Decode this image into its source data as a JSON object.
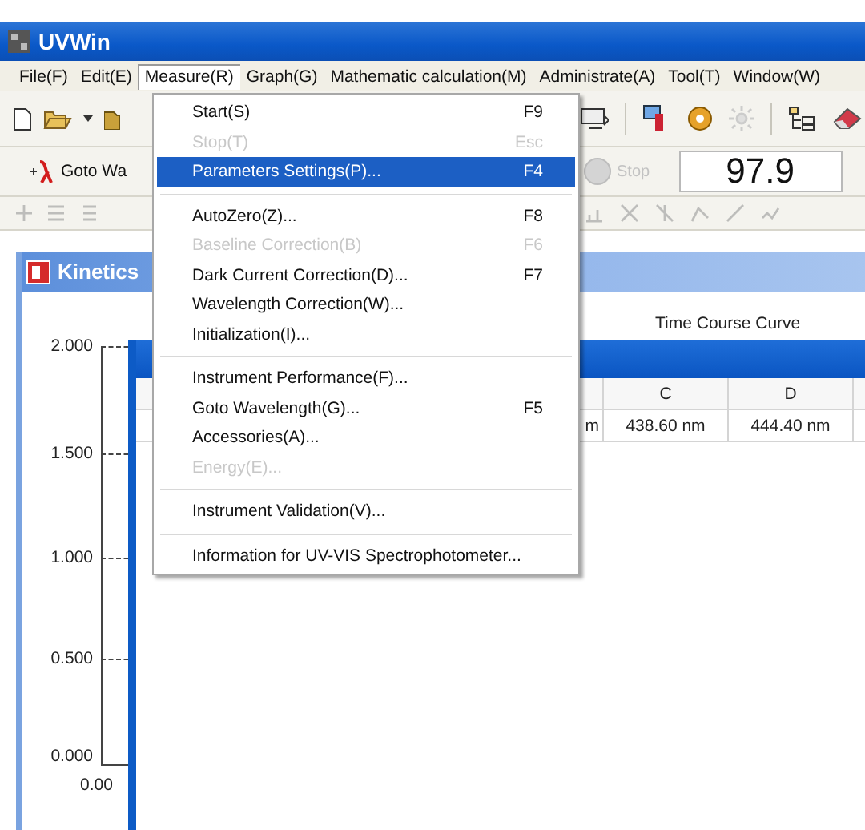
{
  "window": {
    "title": "UVWin"
  },
  "menu_bar": [
    {
      "label": "File(F)",
      "selected": false
    },
    {
      "label": "Edit(E)",
      "selected": false
    },
    {
      "label": "Measure(R)",
      "selected": true
    },
    {
      "label": "Graph(G)",
      "selected": false
    },
    {
      "label": "Mathematic calculation(M)",
      "selected": false
    },
    {
      "label": "Administrate(A)",
      "selected": false
    },
    {
      "label": "Tool(T)",
      "selected": false
    },
    {
      "label": "Window(W)",
      "selected": false
    }
  ],
  "toolbar": {
    "goto_button": "Goto Wa",
    "stop_button": {
      "label": "Stop",
      "disabled": true
    },
    "reading": "97.9"
  },
  "measure_menu": [
    {
      "kind": "item",
      "label": "Start(S)",
      "shortcut": "F9",
      "disabled": false,
      "selected": false
    },
    {
      "kind": "item",
      "label": "Stop(T)",
      "shortcut": "Esc",
      "disabled": true,
      "selected": false
    },
    {
      "kind": "item",
      "label": "Parameters Settings(P)...",
      "shortcut": "F4",
      "disabled": false,
      "selected": true
    },
    {
      "kind": "separator"
    },
    {
      "kind": "item",
      "label": "AutoZero(Z)...",
      "shortcut": "F8",
      "disabled": false,
      "selected": false
    },
    {
      "kind": "item",
      "label": "Baseline Correction(B)",
      "shortcut": "F6",
      "disabled": true,
      "selected": false
    },
    {
      "kind": "item",
      "label": "Dark Current Correction(D)...",
      "shortcut": "F7",
      "disabled": false,
      "selected": false
    },
    {
      "kind": "item",
      "label": "Wavelength Correction(W)...",
      "disabled": false,
      "selected": false
    },
    {
      "kind": "item",
      "label": "Initialization(I)...",
      "disabled": false,
      "selected": false
    },
    {
      "kind": "separator"
    },
    {
      "kind": "item",
      "label": "Instrument Performance(F)...",
      "disabled": false,
      "selected": false
    },
    {
      "kind": "item",
      "label": "Goto Wavelength(G)...",
      "shortcut": "F5",
      "disabled": false,
      "selected": false
    },
    {
      "kind": "item",
      "label": "Accessories(A)...",
      "disabled": false,
      "selected": false
    },
    {
      "kind": "item",
      "label": "Energy(E)...",
      "disabled": true,
      "selected": false
    },
    {
      "kind": "separator"
    },
    {
      "kind": "item",
      "label": "Instrument Validation(V)...",
      "disabled": false,
      "selected": false
    },
    {
      "kind": "separator"
    },
    {
      "kind": "item",
      "label": "Information for UV-VIS Spectrophotometer...",
      "disabled": false,
      "selected": false
    }
  ],
  "kinetics_window": {
    "title": "Kinetics",
    "graph_title": "Time Course Curve",
    "y_ticks": [
      "2.000",
      "1.500",
      "1.000",
      "0.500",
      "0.000"
    ],
    "x_ticks": [
      "0.00"
    ],
    "table": {
      "columns": [
        "",
        "C",
        "D"
      ],
      "rows": [
        [
          "m",
          "438.60 nm",
          "444.40 nm"
        ]
      ]
    }
  }
}
